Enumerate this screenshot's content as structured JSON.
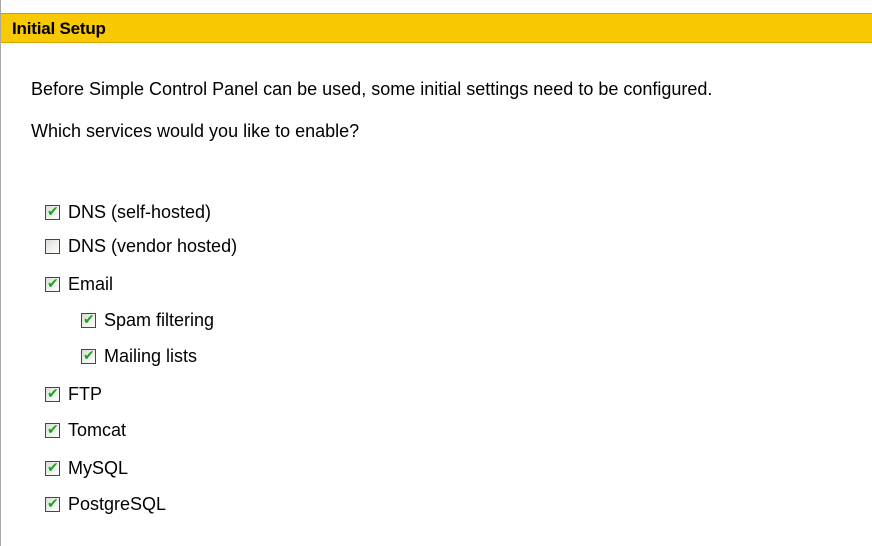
{
  "panel": {
    "title": "Initial Setup",
    "intro": "Before Simple Control Panel can be used, some initial settings need to be configured.",
    "question": "Which services would you like to enable?"
  },
  "services": [
    {
      "label": "DNS (self-hosted)",
      "checked": true,
      "indent": 0
    },
    {
      "label": "DNS (vendor hosted)",
      "checked": false,
      "indent": 0
    },
    {
      "label": "Email",
      "checked": true,
      "indent": 0
    },
    {
      "label": "Spam filtering",
      "checked": true,
      "indent": 1
    },
    {
      "label": "Mailing lists",
      "checked": true,
      "indent": 1
    },
    {
      "label": "FTP",
      "checked": true,
      "indent": 0
    },
    {
      "label": "Tomcat",
      "checked": true,
      "indent": 0
    },
    {
      "label": "MySQL",
      "checked": true,
      "indent": 0
    },
    {
      "label": "PostgreSQL",
      "checked": true,
      "indent": 0
    }
  ],
  "colors": {
    "titlebar": "#f8c800",
    "checkmark": "#21a121",
    "checkbox_border": "#1c5180"
  },
  "icons": {
    "checkmark": "check-icon"
  }
}
